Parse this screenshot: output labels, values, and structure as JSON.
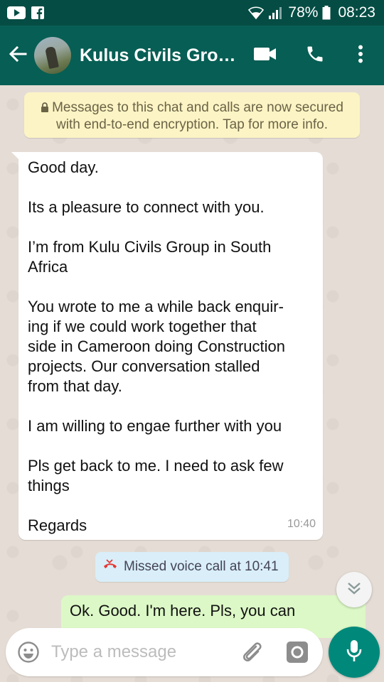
{
  "status_bar": {
    "battery": "78%",
    "time": "08:23",
    "icons": [
      "youtube-icon",
      "facebook-icon",
      "wifi-icon",
      "signal-icon",
      "battery-icon"
    ]
  },
  "header": {
    "title": "Kulus Civils Grou…",
    "icons": [
      "back-arrow-icon",
      "video-call-icon",
      "phone-icon",
      "more-vert-icon"
    ]
  },
  "encryption_notice": {
    "line1": "Messages to this chat and calls are now secured",
    "line2": "with end-to-end encryption. Tap for more info."
  },
  "incoming_message": {
    "lines": [
      "Good day.",
      "",
      "Its a pleasure to connect with you.",
      "",
      "I’m from Kulu Civils Group in South",
      "Africa",
      "",
      "You wrote to me a while back enquir-",
      "ing if we could work together that",
      "side in Cameroon doing Construction",
      "projects. Our conversation stalled",
      "from that day.",
      "",
      "I am willing to engae further with you",
      "",
      "Pls get back to me. I need to ask few",
      "things",
      "",
      "Regards"
    ],
    "time": "10:40"
  },
  "missed_call": {
    "text": "Missed voice call at 10:41"
  },
  "outgoing_message": {
    "text": "Ok. Good. I'm here. Pls, you can"
  },
  "composer": {
    "placeholder": "Type a message"
  },
  "colors": {
    "header": "#075e54",
    "status_bar": "#054d44",
    "chat_bg": "#e5ddd5",
    "outgoing_bubble": "#dcf8c6",
    "fab": "#00897b",
    "missed_call_icon": "#e53935"
  }
}
